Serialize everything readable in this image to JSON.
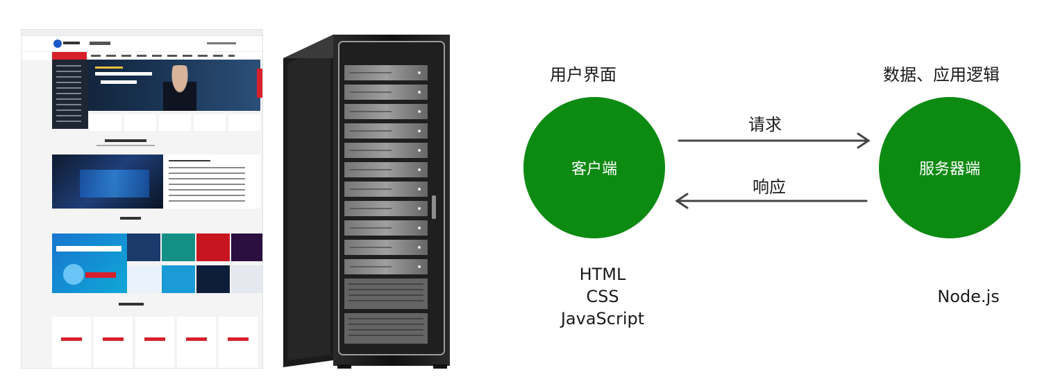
{
  "diagram": {
    "client": {
      "caption": "用户界面",
      "node": "客户端",
      "technologies": [
        "HTML",
        "CSS",
        "JavaScript"
      ]
    },
    "server": {
      "caption": "数据、应用逻辑",
      "node": "服务器端",
      "technologies": [
        "Node.js"
      ]
    },
    "edges": {
      "request": "请求",
      "response": "响应"
    }
  },
  "colors": {
    "node_fill": "#0d8a12",
    "node_text": "#ffffff",
    "arrow": "#444444",
    "text": "#1a1a1a"
  },
  "icons": {
    "left_image": "website-screenshot-image",
    "middle_image": "server-rack-image"
  }
}
